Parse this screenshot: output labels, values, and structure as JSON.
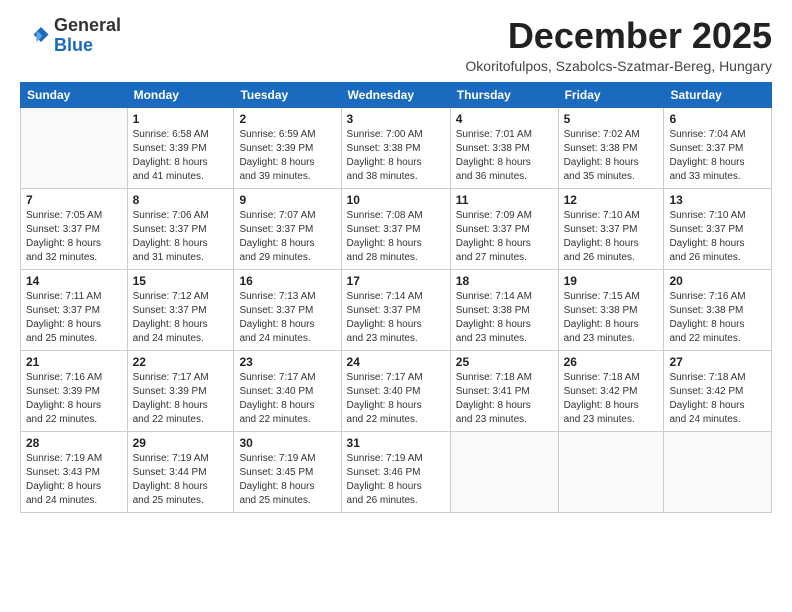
{
  "header": {
    "logo_general": "General",
    "logo_blue": "Blue",
    "month_title": "December 2025",
    "location": "Okoritofulpos, Szabolcs-Szatmar-Bereg, Hungary"
  },
  "weekdays": [
    "Sunday",
    "Monday",
    "Tuesday",
    "Wednesday",
    "Thursday",
    "Friday",
    "Saturday"
  ],
  "weeks": [
    [
      {
        "day": "",
        "info": ""
      },
      {
        "day": "1",
        "info": "Sunrise: 6:58 AM\nSunset: 3:39 PM\nDaylight: 8 hours\nand 41 minutes."
      },
      {
        "day": "2",
        "info": "Sunrise: 6:59 AM\nSunset: 3:39 PM\nDaylight: 8 hours\nand 39 minutes."
      },
      {
        "day": "3",
        "info": "Sunrise: 7:00 AM\nSunset: 3:38 PM\nDaylight: 8 hours\nand 38 minutes."
      },
      {
        "day": "4",
        "info": "Sunrise: 7:01 AM\nSunset: 3:38 PM\nDaylight: 8 hours\nand 36 minutes."
      },
      {
        "day": "5",
        "info": "Sunrise: 7:02 AM\nSunset: 3:38 PM\nDaylight: 8 hours\nand 35 minutes."
      },
      {
        "day": "6",
        "info": "Sunrise: 7:04 AM\nSunset: 3:37 PM\nDaylight: 8 hours\nand 33 minutes."
      }
    ],
    [
      {
        "day": "7",
        "info": "Sunrise: 7:05 AM\nSunset: 3:37 PM\nDaylight: 8 hours\nand 32 minutes."
      },
      {
        "day": "8",
        "info": "Sunrise: 7:06 AM\nSunset: 3:37 PM\nDaylight: 8 hours\nand 31 minutes."
      },
      {
        "day": "9",
        "info": "Sunrise: 7:07 AM\nSunset: 3:37 PM\nDaylight: 8 hours\nand 29 minutes."
      },
      {
        "day": "10",
        "info": "Sunrise: 7:08 AM\nSunset: 3:37 PM\nDaylight: 8 hours\nand 28 minutes."
      },
      {
        "day": "11",
        "info": "Sunrise: 7:09 AM\nSunset: 3:37 PM\nDaylight: 8 hours\nand 27 minutes."
      },
      {
        "day": "12",
        "info": "Sunrise: 7:10 AM\nSunset: 3:37 PM\nDaylight: 8 hours\nand 26 minutes."
      },
      {
        "day": "13",
        "info": "Sunrise: 7:10 AM\nSunset: 3:37 PM\nDaylight: 8 hours\nand 26 minutes."
      }
    ],
    [
      {
        "day": "14",
        "info": "Sunrise: 7:11 AM\nSunset: 3:37 PM\nDaylight: 8 hours\nand 25 minutes."
      },
      {
        "day": "15",
        "info": "Sunrise: 7:12 AM\nSunset: 3:37 PM\nDaylight: 8 hours\nand 24 minutes."
      },
      {
        "day": "16",
        "info": "Sunrise: 7:13 AM\nSunset: 3:37 PM\nDaylight: 8 hours\nand 24 minutes."
      },
      {
        "day": "17",
        "info": "Sunrise: 7:14 AM\nSunset: 3:37 PM\nDaylight: 8 hours\nand 23 minutes."
      },
      {
        "day": "18",
        "info": "Sunrise: 7:14 AM\nSunset: 3:38 PM\nDaylight: 8 hours\nand 23 minutes."
      },
      {
        "day": "19",
        "info": "Sunrise: 7:15 AM\nSunset: 3:38 PM\nDaylight: 8 hours\nand 23 minutes."
      },
      {
        "day": "20",
        "info": "Sunrise: 7:16 AM\nSunset: 3:38 PM\nDaylight: 8 hours\nand 22 minutes."
      }
    ],
    [
      {
        "day": "21",
        "info": "Sunrise: 7:16 AM\nSunset: 3:39 PM\nDaylight: 8 hours\nand 22 minutes."
      },
      {
        "day": "22",
        "info": "Sunrise: 7:17 AM\nSunset: 3:39 PM\nDaylight: 8 hours\nand 22 minutes."
      },
      {
        "day": "23",
        "info": "Sunrise: 7:17 AM\nSunset: 3:40 PM\nDaylight: 8 hours\nand 22 minutes."
      },
      {
        "day": "24",
        "info": "Sunrise: 7:17 AM\nSunset: 3:40 PM\nDaylight: 8 hours\nand 22 minutes."
      },
      {
        "day": "25",
        "info": "Sunrise: 7:18 AM\nSunset: 3:41 PM\nDaylight: 8 hours\nand 23 minutes."
      },
      {
        "day": "26",
        "info": "Sunrise: 7:18 AM\nSunset: 3:42 PM\nDaylight: 8 hours\nand 23 minutes."
      },
      {
        "day": "27",
        "info": "Sunrise: 7:18 AM\nSunset: 3:42 PM\nDaylight: 8 hours\nand 24 minutes."
      }
    ],
    [
      {
        "day": "28",
        "info": "Sunrise: 7:19 AM\nSunset: 3:43 PM\nDaylight: 8 hours\nand 24 minutes."
      },
      {
        "day": "29",
        "info": "Sunrise: 7:19 AM\nSunset: 3:44 PM\nDaylight: 8 hours\nand 25 minutes."
      },
      {
        "day": "30",
        "info": "Sunrise: 7:19 AM\nSunset: 3:45 PM\nDaylight: 8 hours\nand 25 minutes."
      },
      {
        "day": "31",
        "info": "Sunrise: 7:19 AM\nSunset: 3:46 PM\nDaylight: 8 hours\nand 26 minutes."
      },
      {
        "day": "",
        "info": ""
      },
      {
        "day": "",
        "info": ""
      },
      {
        "day": "",
        "info": ""
      }
    ]
  ]
}
